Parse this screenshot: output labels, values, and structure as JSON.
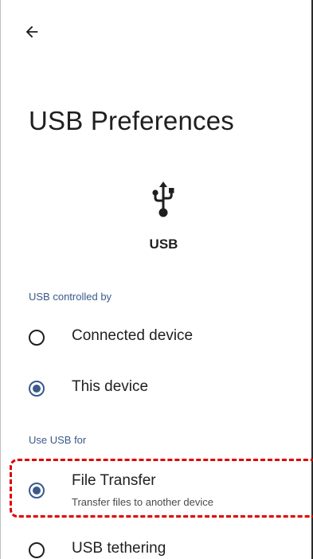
{
  "header": {
    "back_icon": "arrow-back-icon"
  },
  "page": {
    "title": "USB Preferences",
    "usb_icon": "usb-icon",
    "usb_label": "USB"
  },
  "sections": {
    "controlled_by": {
      "header": "USB controlled by",
      "options": [
        {
          "title": "Connected device",
          "selected": false
        },
        {
          "title": "This device",
          "selected": true
        }
      ]
    },
    "use_for": {
      "header": "Use USB for",
      "options": [
        {
          "title": "File Transfer",
          "summary": "Transfer files to another device",
          "selected": true
        },
        {
          "title": "USB tethering",
          "selected": false
        }
      ]
    }
  },
  "colors": {
    "accent": "#3a5a8c",
    "highlight": "#e00000"
  }
}
